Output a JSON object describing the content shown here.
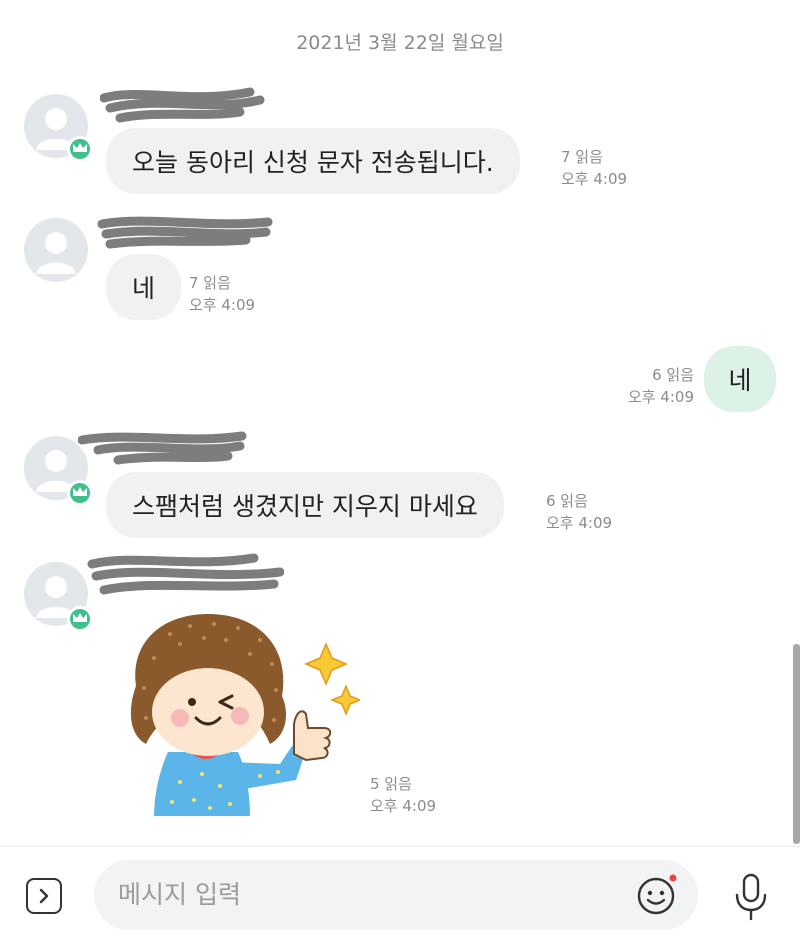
{
  "date_header": "2021년 3월 22일 월요일",
  "messages": [
    {
      "text": "오늘 동아리 신청 문자 전송됩니다.",
      "read": "7 읽음",
      "time": "오후 4:09"
    },
    {
      "text": "네",
      "read": "7 읽음",
      "time": "오후 4:09"
    },
    {
      "text": "네",
      "read": "6 읽음",
      "time": "오후 4:09"
    },
    {
      "text": "스팸처럼 생겼지만 지우지 마세요",
      "read": "6 읽음",
      "time": "오후 4:09"
    },
    {
      "read": "5 읽음",
      "time": "오후 4:09"
    }
  ],
  "input": {
    "placeholder": "메시지 입력"
  },
  "icons": {
    "expand": "chevron-right-icon",
    "emoji": "smiley-icon",
    "mic": "microphone-icon",
    "crown": "crown-icon",
    "avatar": "person-icon"
  },
  "colors": {
    "my_bubble": "#dcf2e6",
    "other_bubble": "#f0f1f3",
    "badge": "#3fbf8a",
    "notify_dot": "#e8453c"
  }
}
